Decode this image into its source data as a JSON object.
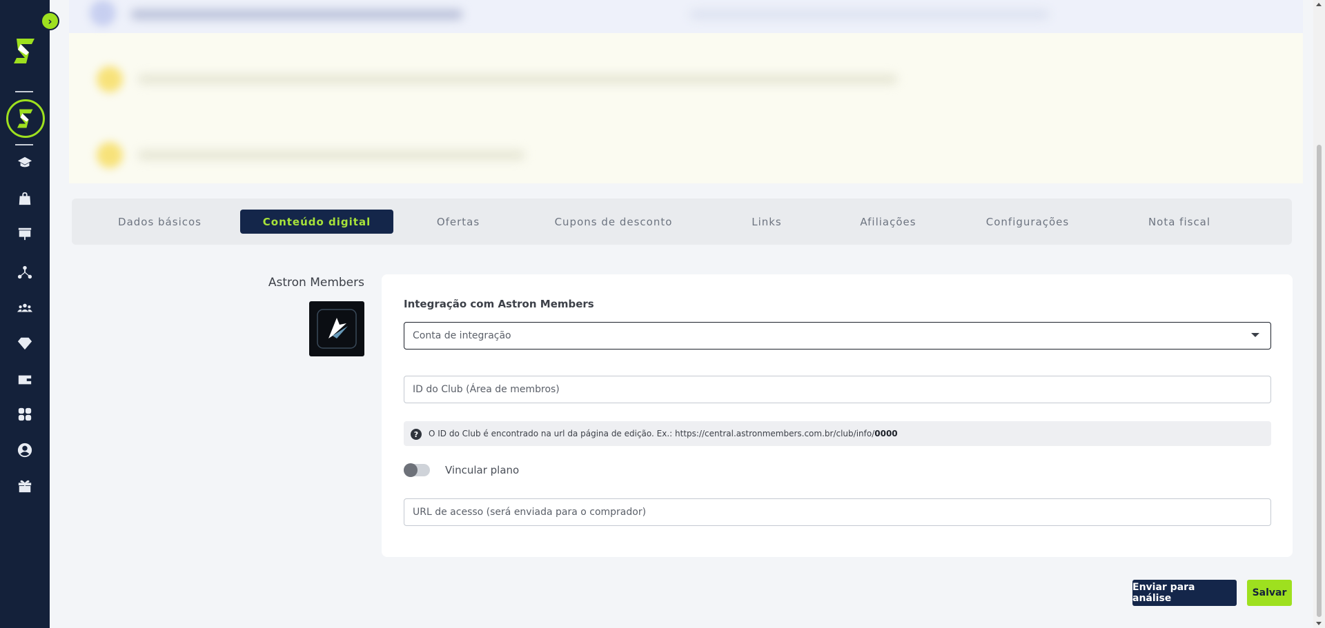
{
  "sidebar": {
    "toggle_icon": "chevron-right-icon",
    "icons": [
      "academy-icon",
      "shopping-bag-icon",
      "dashboard-chart-icon",
      "network-icon",
      "users-icon",
      "diamond-icon",
      "wallet-icon",
      "apps-icon",
      "user-circle-icon",
      "gift-icon"
    ],
    "accent": "#9ee01f",
    "background": "#14213a"
  },
  "tabs": [
    {
      "label": "Dados básicos",
      "active": false
    },
    {
      "label": "Conteúdo digital",
      "active": true
    },
    {
      "label": "Ofertas",
      "active": false
    },
    {
      "label": "Cupons de desconto",
      "active": false
    },
    {
      "label": "Links",
      "active": false
    },
    {
      "label": "Afiliações",
      "active": false
    },
    {
      "label": "Configurações",
      "active": false
    },
    {
      "label": "Nota fiscal",
      "active": false
    }
  ],
  "integration": {
    "name": "Astron Members",
    "card_title": "Integração com Astron Members",
    "account_select_placeholder": "Conta de integração",
    "club_id_placeholder": "ID do Club (Área de membros)",
    "hint_text": "O ID do Club é encontrado na url da página de edição. Ex.: https://central.astronmembers.com.br/club/info/",
    "hint_example_id": "0000",
    "link_plan_label": "Vincular plano",
    "link_plan_enabled": false,
    "access_url_placeholder": "URL de acesso (será enviada para o comprador)"
  },
  "actions": {
    "submit_label": "Enviar para análise",
    "save_label": "Salvar"
  }
}
